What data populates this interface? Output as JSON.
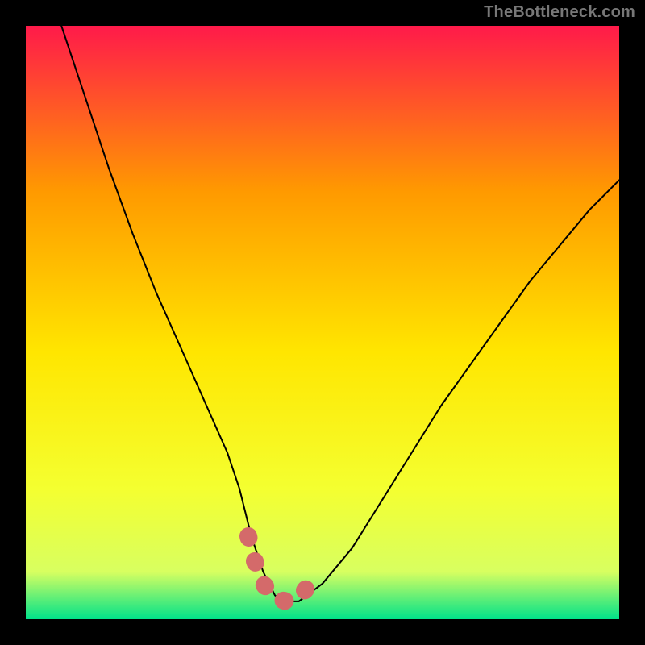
{
  "attribution": "TheBottleneck.com",
  "chart_data": {
    "type": "line",
    "title": "",
    "xlabel": "",
    "ylabel": "",
    "xlim": [
      0,
      100
    ],
    "ylim": [
      0,
      100
    ],
    "series": [
      {
        "name": "bottleneck-curve",
        "x": [
          6,
          10,
          14,
          18,
          22,
          26,
          30,
          34,
          36,
          38,
          40,
          42,
          44,
          46,
          50,
          55,
          60,
          65,
          70,
          75,
          80,
          85,
          90,
          95,
          100
        ],
        "values": [
          100,
          88,
          76,
          65,
          55,
          46,
          37,
          28,
          22,
          14,
          8,
          4,
          3,
          3,
          6,
          12,
          20,
          28,
          36,
          43,
          50,
          57,
          63,
          69,
          74
        ]
      }
    ],
    "optimal_marker": {
      "name": "optimal-range",
      "x": [
        37.5,
        38.5,
        40,
        42,
        44,
        46,
        47.5,
        48.5
      ],
      "values": [
        14,
        10,
        6,
        3.5,
        3,
        3.5,
        5.5,
        8.5
      ]
    },
    "background_gradient": {
      "top": "#ff1a4a",
      "upper_mid": "#ff9a00",
      "mid": "#ffe600",
      "lower_mid": "#f4ff30",
      "near_bottom": "#d8ff60",
      "bottom": "#00e28a"
    }
  }
}
